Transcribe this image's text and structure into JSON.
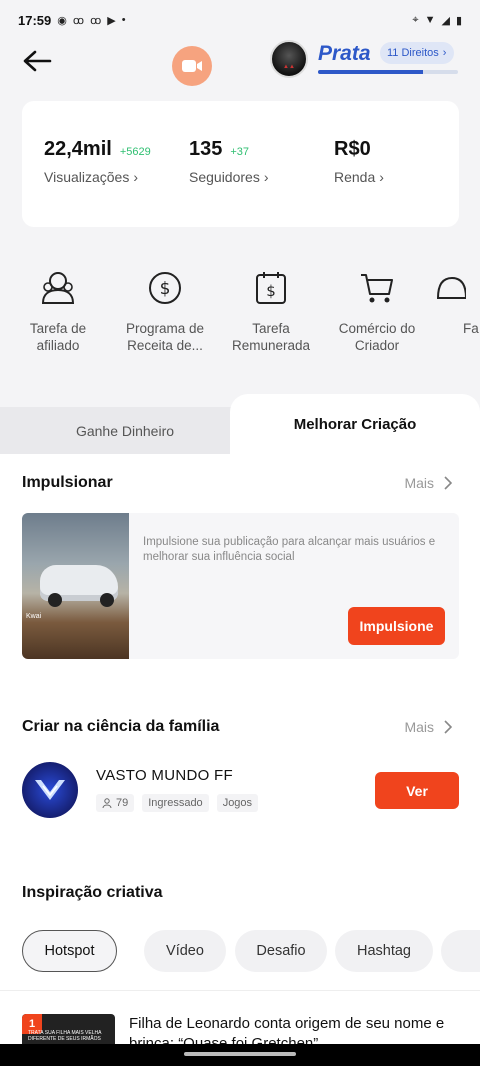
{
  "status_bar": {
    "time": "17:59"
  },
  "header": {
    "level_name": "Prata",
    "rights_label": "11 Direitos",
    "level_progress": 0.75
  },
  "stats": [
    {
      "value": "22,4mil",
      "delta": "+5629",
      "label": "Visualizações"
    },
    {
      "value": "135",
      "delta": "+37",
      "label": "Seguidores"
    },
    {
      "value": "R$0",
      "delta": "",
      "label": "Renda"
    }
  ],
  "tools": [
    {
      "icon": "affiliate-icon",
      "label_line1": "Tarefa de",
      "label_line2": "afiliado"
    },
    {
      "icon": "dollar-circle-icon",
      "label_line1": "Programa de",
      "label_line2": "Receita de..."
    },
    {
      "icon": "dollar-calendar-icon",
      "label_line1": "Tarefa",
      "label_line2": "Remunerada"
    },
    {
      "icon": "cart-icon",
      "label_line1": "Comércio do",
      "label_line2": "Criador"
    },
    {
      "icon": "bell-icon",
      "label_line1": "Fa",
      "label_line2": ""
    }
  ],
  "tabs": {
    "left": "Ganhe Dinheiro",
    "right": "Melhorar Criação"
  },
  "boost": {
    "title": "Impulsionar",
    "more": "Mais",
    "description": "Impulsione sua publicação para alcançar mais usuários e melhorar sua influência social",
    "button": "Impulsione",
    "thumb_tag": "Kwai"
  },
  "family": {
    "title": "Criar na ciência da família",
    "more": "Mais",
    "name": "VASTO MUNDO FF",
    "members": "79",
    "status": "Ingressado",
    "category": "Jogos",
    "button": "Ver"
  },
  "inspiration": {
    "title": "Inspiração criativa",
    "filters": [
      "Hotspot",
      "Vídeo",
      "Desafio",
      "Hashtag"
    ],
    "active_filter": "Hotspot"
  },
  "news": [
    {
      "rank": "1",
      "thumb_text": "TRATA SUA FILHA MAIS VELHA DIFERENTE DE SEUS IRMÃOS",
      "title": "Filha de Leonardo conta origem de seu nome e brinca: “Quase foi Gretchen”"
    }
  ],
  "colors": {
    "accent": "#f0441d",
    "level_blue": "#2d58c8",
    "positive": "#2fbf71"
  }
}
